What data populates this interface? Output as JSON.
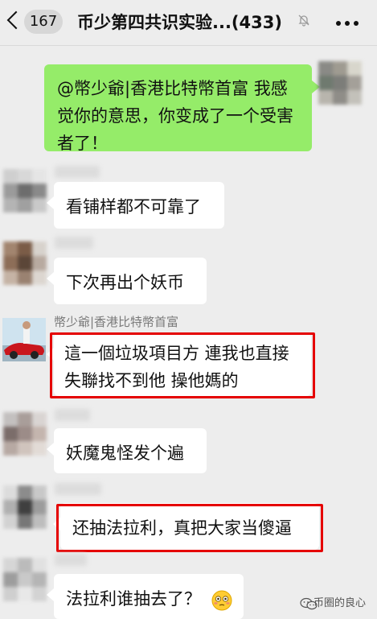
{
  "header": {
    "unread_count": "167",
    "title": "币少第四共识实验...(433)"
  },
  "messages": {
    "own_message": "@幣少爺|香港比特幣首富 我感觉你的意思，你变成了一个受害者了！",
    "m1": "看铺样都不可靠了",
    "m2": "下次再出个妖币",
    "m3_sender": "幣少爺|香港比特幣首富",
    "m3": "這一個垃圾項目方 連我也直接失聯找不到他 操他媽的",
    "m4": "妖魔鬼怪发个遍",
    "m5": "还抽法拉利，真把大家当傻逼",
    "m6": "法拉利谁抽去了？"
  },
  "watermark": {
    "text": "币圈的良心"
  },
  "colors": {
    "own_bubble": "#95ec69",
    "highlight_box": "#e50000",
    "background": "#ededed"
  }
}
